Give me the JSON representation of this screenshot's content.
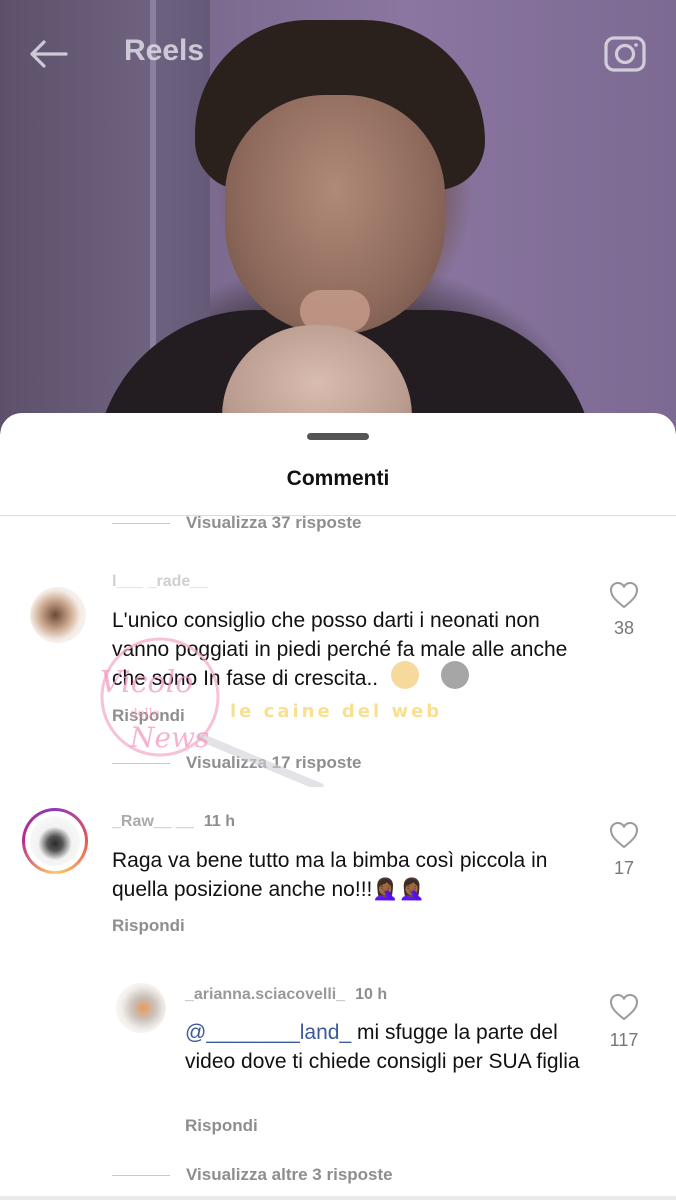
{
  "header": {
    "title": "Reels"
  },
  "sheet": {
    "title": "Commenti"
  },
  "comments": [
    {
      "view_replies": "Visualizza 37 risposte"
    },
    {
      "username": "l___ _rade__",
      "text": "L'unico consiglio che posso darti i neonati non vanno poggiati in piedi perché fa male alle anche che sono In fase di crescita..",
      "reply_label": "Rispondi",
      "likes": "38",
      "view_replies": "Visualizza 17 risposte"
    },
    {
      "username": "_Raw__ __",
      "time": "11 h",
      "text": "Raga va bene tutto ma la bimba così piccola in quella posizione anche no!!!🤦🏾‍♀️🤦🏾‍♀️",
      "reply_label": "Rispondi",
      "likes": "17"
    },
    {
      "username": "_arianna.sciacovelli_",
      "time": "10 h",
      "mention": "@________land_",
      "text": " mi sfugge la parte del video dove ti chiede consigli per SUA figlia",
      "reply_label": "Rispondi",
      "likes": "117",
      "view_replies": "Visualizza altre 3 risposte"
    }
  ],
  "watermark": {
    "brand_left": "Vicolo delle News",
    "brand_right": "le caine del web"
  },
  "colors": {
    "accent_link": "#3b5a9a",
    "muted": "#8e8e8e"
  }
}
